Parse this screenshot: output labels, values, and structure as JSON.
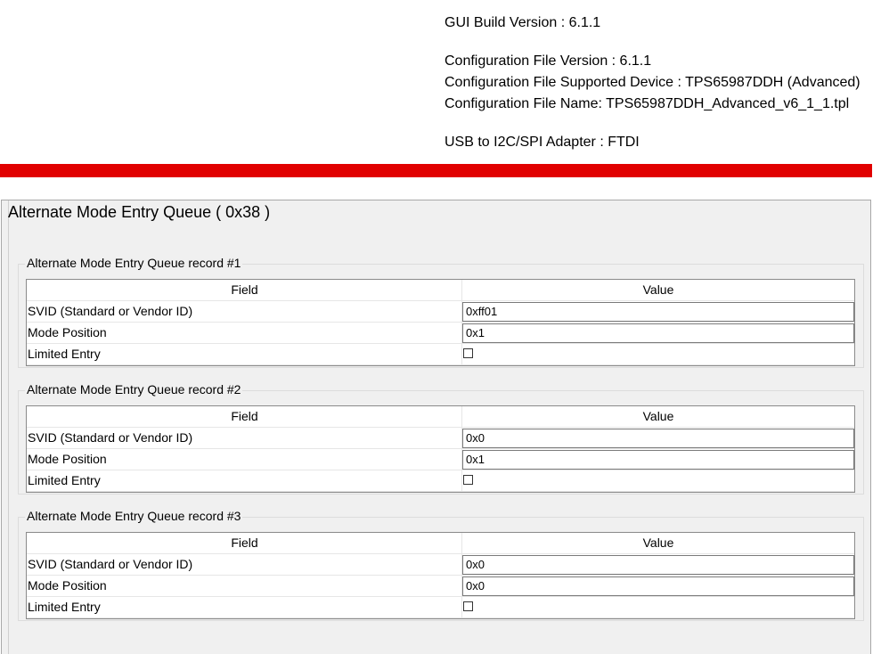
{
  "header": {
    "gui_build_version": "GUI Build Version : 6.1.1",
    "config_file_version": "Configuration File Version : 6.1.1",
    "config_supported_device": "Configuration File Supported Device : TPS65987DDH (Advanced)",
    "config_file_name": "Configuration File Name: TPS65987DDH_Advanced_v6_1_1.tpl",
    "usb_adapter": "USB to I2C/SPI Adapter : FTDI"
  },
  "colors": {
    "accent_bar": "#e10000"
  },
  "panel": {
    "title": "Alternate Mode Entry Queue  ( 0x38 )"
  },
  "table_headers": {
    "field": "Field",
    "value": "Value"
  },
  "records": [
    {
      "title": "Alternate Mode Entry Queue record #1",
      "rows": [
        {
          "field": "SVID (Standard or Vendor ID)",
          "value": "0xff01"
        },
        {
          "field": "Mode Position",
          "value": "0x1"
        },
        {
          "field": "Limited Entry",
          "checked": false
        }
      ]
    },
    {
      "title": "Alternate Mode Entry Queue record #2",
      "rows": [
        {
          "field": "SVID (Standard or Vendor ID)",
          "value": "0x0"
        },
        {
          "field": "Mode Position",
          "value": "0x1"
        },
        {
          "field": "Limited Entry",
          "checked": false
        }
      ]
    },
    {
      "title": "Alternate Mode Entry Queue record #3",
      "rows": [
        {
          "field": "SVID (Standard or Vendor ID)",
          "value": "0x0"
        },
        {
          "field": "Mode Position",
          "value": "0x0"
        },
        {
          "field": "Limited Entry",
          "checked": false
        }
      ]
    }
  ]
}
